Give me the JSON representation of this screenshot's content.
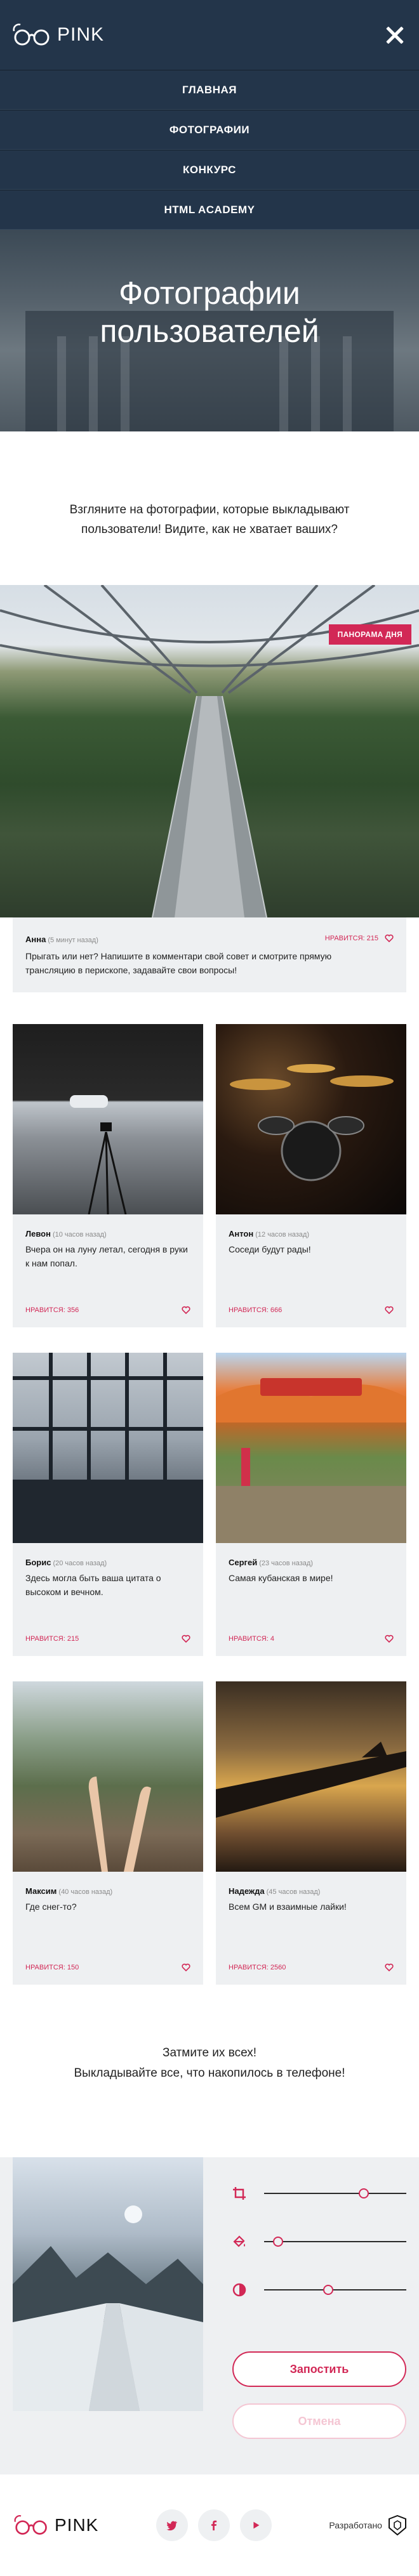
{
  "header": {
    "logo_text": "PINK",
    "menu": [
      "Главная",
      "Фотографии",
      "Конкурс",
      "HTML Academy"
    ],
    "title": "Фотографии пользователей"
  },
  "intro": "Взгляните на фотографии, которые выкладывают пользователи! Видите, как не хватает ваших?",
  "featured": {
    "badge": "Панорама дня",
    "author": "Анна",
    "time": "(5 минут назад)",
    "likes": "Нравится: 215",
    "text": "Прыгать или нет? Напишите в комментари свой совет и смотрите прямую трансляцию в перископе, задавайте свои вопросы!"
  },
  "cards": [
    {
      "author": "Левон",
      "time": "(10 часов назад)",
      "text": "Вчера он на луну летал, сегодня в руки к нам попал.",
      "likes": "Нравится: 356"
    },
    {
      "author": "Антон",
      "time": "(12 часов назад)",
      "text": "Соседи будут рады!",
      "likes": "Нравится: 666"
    },
    {
      "author": "Борис",
      "time": "(20 часов назад)",
      "text": "Здесь могла быть ваша цитата о высоком и вечном.",
      "likes": "Нравится: 215"
    },
    {
      "author": "Сергей",
      "time": "(23 часов назад)",
      "text": "Самая кубанская в мире!",
      "likes": "Нравится: 4"
    },
    {
      "author": "Максим",
      "time": "(40 часов назад)",
      "text": "Где снег-то?",
      "likes": "Нравится: 150"
    },
    {
      "author": "Надежда",
      "time": "(45 часов назад)",
      "text": "Всем GM и взаимные лайки!",
      "likes": "Нравится: 2560"
    }
  ],
  "cta": {
    "line1": "Затмите их всех!",
    "line2": "Выкладывайте все, что накопилось в телефоне!"
  },
  "editor": {
    "crop_value": 0.7,
    "fill_value": 0.1,
    "contrast_value": 0.45,
    "submit_label": "Запостить",
    "reset_label": "Отмена"
  },
  "footer": {
    "logo_text": "PINK",
    "socials": [
      "twitter",
      "facebook",
      "youtube"
    ],
    "developed_label": "Разработано"
  },
  "colors": {
    "accent": "#d22856",
    "header_bg": "#23354a",
    "card_bg": "#eef0f2"
  }
}
